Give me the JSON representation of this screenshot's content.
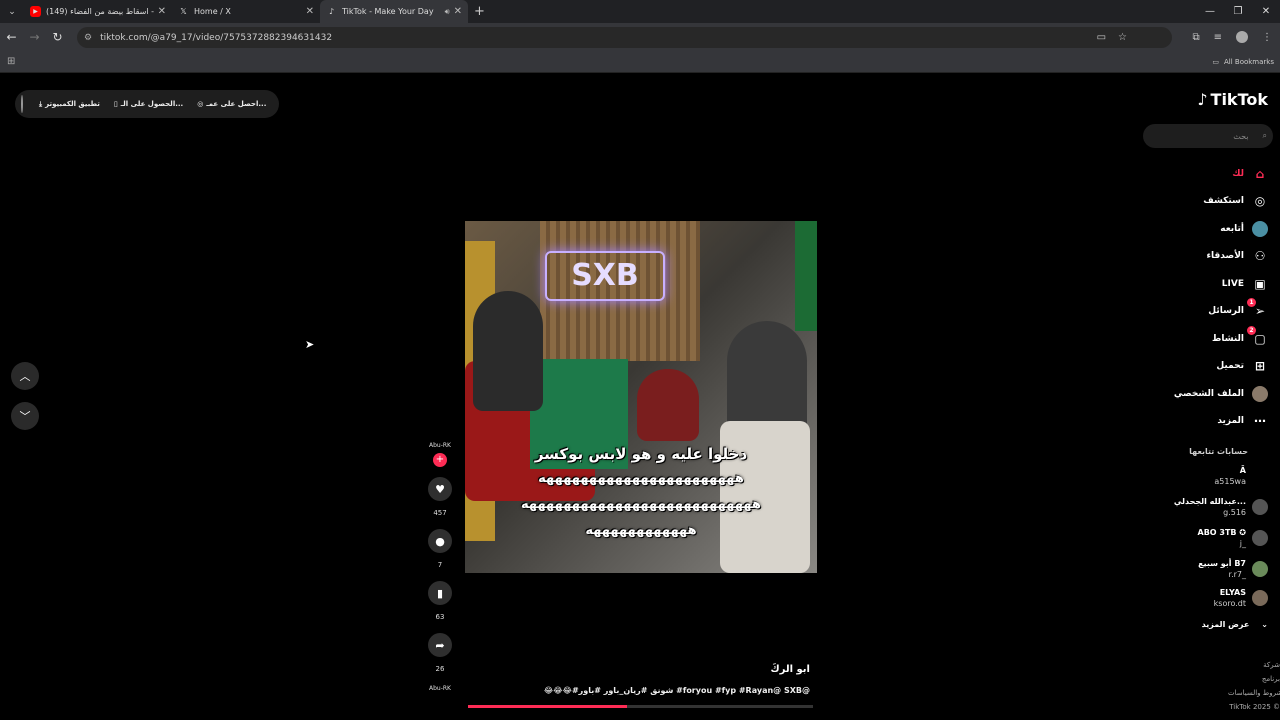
{
  "browser": {
    "tabs": [
      {
        "title": "(149) اسقاط بيضة من الفضاء - ...",
        "active": false
      },
      {
        "title": "Home / X",
        "active": false
      },
      {
        "title": "TikTok - Make Your Day",
        "active": true
      }
    ],
    "url": "tiktok.com/@a79_17/video/7575372882394631432",
    "bookmarks_label": "All Bookmarks"
  },
  "promo": {
    "item1": "احصل على عمـ...",
    "item2": "الحصول على الـ...",
    "item3": "تطبيق الكمبيوتر"
  },
  "video": {
    "overlay_logo": "SXB",
    "caption_line1": "دخلوا عليه و هو لابس بوكسر",
    "caption_line2": "هههههههههههههههههههههههه",
    "caption_line3": "هههههههههههههههههههههههههههه",
    "caption_line4": "ههههههههههههه",
    "author": "ابو الركَ",
    "description": "😂😂😂#شونق #ريان_باور #باور #foryou #fyp #Rayan@ SXB@",
    "progress": 0.46
  },
  "actions": {
    "creator_top": "Abu-RK",
    "follow": "+",
    "likes": "457",
    "comments": "7",
    "saves": "63",
    "shares": "26",
    "creator_bottom": "Abu-RK"
  },
  "sidebar": {
    "brand": "TikTok",
    "search_placeholder": "بحث",
    "nav": [
      {
        "label": "لك",
        "icon": "home-icon"
      },
      {
        "label": "استكشف",
        "icon": "compass-icon"
      },
      {
        "label": "أتابعه",
        "icon": "following-avatar-icon"
      },
      {
        "label": "الأصدقاء",
        "icon": "friends-icon"
      },
      {
        "label": "LIVE",
        "icon": "live-icon"
      },
      {
        "label": "الرسائل",
        "icon": "messages-icon",
        "badge": "1"
      },
      {
        "label": "النشاط",
        "icon": "activity-icon",
        "badge": "2"
      },
      {
        "label": "تحميل",
        "icon": "upload-icon"
      },
      {
        "label": "الملف الشخصي",
        "icon": "profile-icon"
      },
      {
        "label": "المزيد",
        "icon": "more-icon"
      }
    ],
    "following_header": "حسابات تتابعها",
    "accounts": [
      {
        "name": "Ā",
        "handle": "a515wa"
      },
      {
        "name": "عبدالله الجحدلي...",
        "handle": "g.516"
      },
      {
        "name": "ABO 3TB ✪",
        "handle": "j_"
      },
      {
        "name": "أبو سبيع B7",
        "handle": "r.r7_"
      },
      {
        "name": "ELYAS",
        "handle": "ksoro.dt"
      }
    ],
    "show_more": "عرض المزيد",
    "footer": [
      "شركة",
      "برنامج",
      "شروط والسياسات",
      "TikTok 2025 ©"
    ]
  },
  "colors": {
    "accent": "#fe2c55",
    "background": "#000000"
  }
}
